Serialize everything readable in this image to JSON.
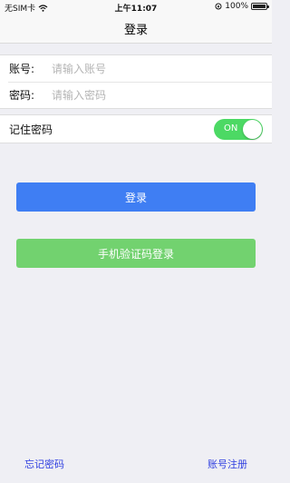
{
  "status_bar": {
    "carrier": "无SIM卡",
    "time": "上午11:07",
    "battery_percent": "100%"
  },
  "nav": {
    "title": "登录"
  },
  "form": {
    "account_label": "账号:",
    "account_placeholder": "请输入账号",
    "password_label": "密码:",
    "password_placeholder": "请输入密码"
  },
  "remember": {
    "label": "记住密码",
    "toggle_text": "ON",
    "toggle_on": true
  },
  "buttons": {
    "login": "登录",
    "sms_login": "手机验证码登录"
  },
  "footer": {
    "forgot_password": "忘记密码",
    "register": "账号注册"
  },
  "colors": {
    "primary": "#3f7ef3",
    "secondary": "#72d26f",
    "toggle": "#4cd964",
    "link": "#2f3fe0"
  }
}
